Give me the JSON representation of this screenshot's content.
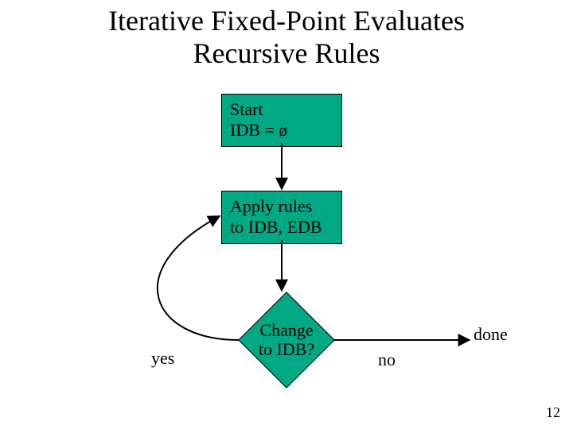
{
  "title_line1": "Iterative Fixed-Point Evaluates",
  "title_line2": "Recursive Rules",
  "nodes": {
    "start": {
      "line1": "Start",
      "line2": "IDB = ø"
    },
    "apply": {
      "line1": "Apply rules",
      "line2": "to IDB, EDB"
    },
    "decision": {
      "line1": "Change",
      "line2": "to IDB?"
    }
  },
  "edges": {
    "yes": "yes",
    "no": "no",
    "done": "done"
  },
  "slide_number": "12"
}
